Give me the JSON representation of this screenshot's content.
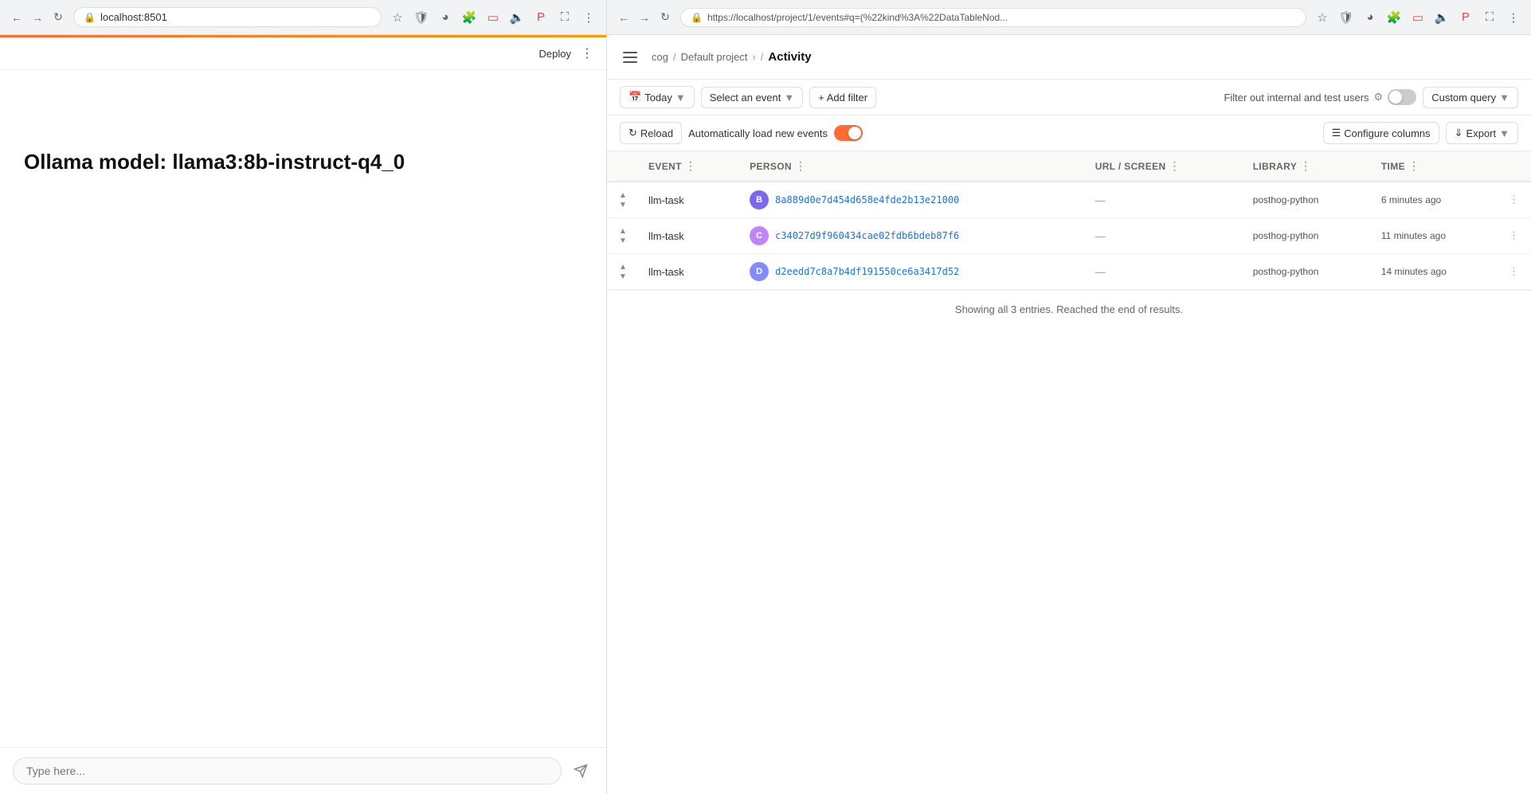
{
  "left": {
    "address": "localhost:8501",
    "deploy_label": "Deploy",
    "heading": "Ollama model: llama3:8b-instruct-q4_0",
    "chat_placeholder": "Type here...",
    "orange_bar": true
  },
  "right": {
    "address": "https://localhost/project/1/events#q=(%22kind%3A%22DataTableNod...",
    "breadcrumb": {
      "cog": "cog",
      "sep1": "/",
      "project": "Default project",
      "chevron": "›",
      "sep2": "/",
      "title": "Activity"
    },
    "filters": {
      "today_label": "Today",
      "select_event_label": "Select an event",
      "add_filter_label": "+ Add filter",
      "internal_users_label": "Filter out internal and test users",
      "custom_query_label": "Custom query"
    },
    "table_controls": {
      "reload_label": "Reload",
      "auto_load_label": "Automatically load new events",
      "configure_cols_label": "Configure columns",
      "export_label": "Export"
    },
    "table": {
      "columns": [
        {
          "key": "expand",
          "label": ""
        },
        {
          "key": "event",
          "label": "EVENT"
        },
        {
          "key": "person",
          "label": "PERSON"
        },
        {
          "key": "url",
          "label": "URL / SCREEN"
        },
        {
          "key": "library",
          "label": "LIBRARY"
        },
        {
          "key": "time",
          "label": "TIME"
        },
        {
          "key": "menu",
          "label": ""
        }
      ],
      "rows": [
        {
          "event": "llm-task",
          "avatar_letter": "B",
          "avatar_color": "#7b68ee",
          "person_id": "8a889d0e7d454d658e4fde2b13e21000",
          "url": "—",
          "library": "posthog-python",
          "time": "6 minutes ago"
        },
        {
          "event": "llm-task",
          "avatar_letter": "C",
          "avatar_color": "#c084fc",
          "person_id": "c34027d9f960434cae02fdb6bdeb87f6",
          "url": "—",
          "library": "posthog-python",
          "time": "11 minutes ago"
        },
        {
          "event": "llm-task",
          "avatar_letter": "D",
          "avatar_color": "#818cf8",
          "person_id": "d2eedd7c8a7b4df191550ce6a3417d52",
          "url": "—",
          "library": "posthog-python",
          "time": "14 minutes ago"
        }
      ],
      "footer": "Showing all 3 entries. Reached the end of results."
    }
  }
}
